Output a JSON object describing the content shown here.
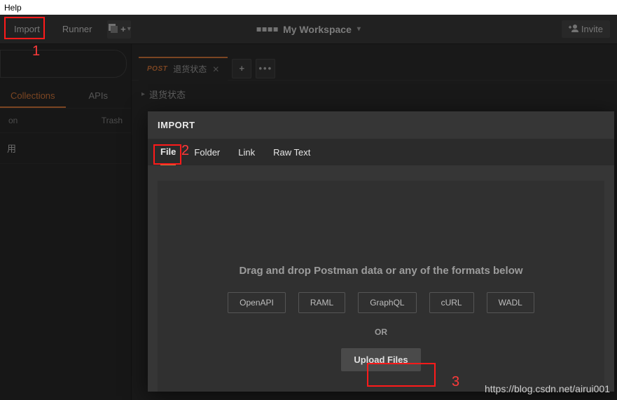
{
  "menubar": {
    "help": "Help"
  },
  "toolbar": {
    "import_label": "Import",
    "runner_label": "Runner",
    "workspace_label": "My Workspace",
    "invite_label": "Invite"
  },
  "sidebar": {
    "tabs": {
      "collections": "Collections",
      "apis": "APIs"
    },
    "row1_left": "on",
    "row1_right": "Trash",
    "item1": "用"
  },
  "tabbar": {
    "method": "POST",
    "title": "退货状态"
  },
  "breadcrumb": {
    "text": "退货状态"
  },
  "import_dialog": {
    "title": "IMPORT",
    "tabs": {
      "file": "File",
      "folder": "Folder",
      "link": "Link",
      "raw": "Raw Text"
    },
    "drop_text": "Drag and drop Postman data or any of the formats below",
    "formats": [
      "OpenAPI",
      "RAML",
      "GraphQL",
      "cURL",
      "WADL"
    ],
    "or": "OR",
    "upload_label": "Upload Files"
  },
  "annotations": {
    "n1": "1",
    "n2": "2",
    "n3": "3"
  },
  "watermark": "https://blog.csdn.net/airui001"
}
